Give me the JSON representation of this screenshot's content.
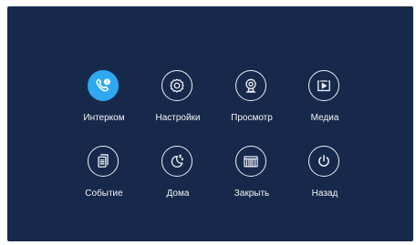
{
  "menu": {
    "items": [
      {
        "label": "Интерком",
        "icon": "intercom-phone-icon",
        "active": true
      },
      {
        "label": "Настройки",
        "icon": "settings-gear-icon",
        "active": false
      },
      {
        "label": "Просмотр",
        "icon": "camera-view-icon",
        "active": false
      },
      {
        "label": "Медиа",
        "icon": "media-play-icon",
        "active": false
      },
      {
        "label": "Событие",
        "icon": "event-document-icon",
        "active": false
      },
      {
        "label": "Дома",
        "icon": "home-moon-icon",
        "active": false
      },
      {
        "label": "Закрыть",
        "icon": "close-gate-icon",
        "active": false
      },
      {
        "label": "Назад",
        "icon": "power-back-icon",
        "active": false
      }
    ]
  },
  "colors": {
    "background": "#17294a",
    "active": "#2ea8f0",
    "foreground": "#e9eef6"
  }
}
